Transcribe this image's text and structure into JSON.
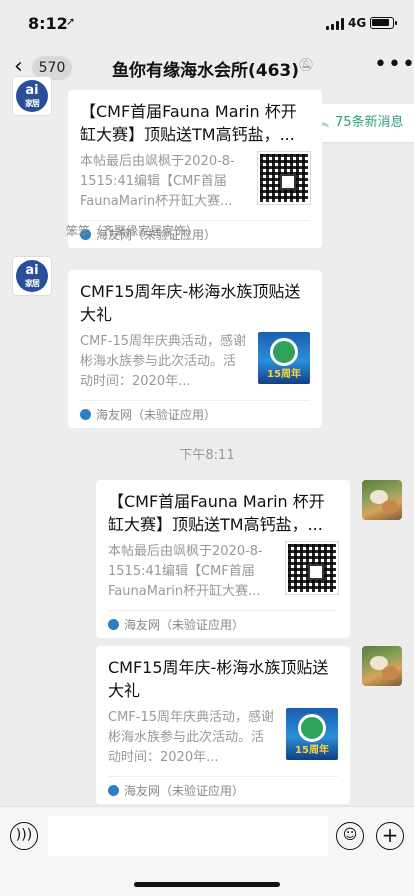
{
  "status_bar": {
    "time": "8:12",
    "location_icon": "location-arrow-icon",
    "network": "4G"
  },
  "nav": {
    "back_icon": "chevron-left-icon",
    "unread_count": "570",
    "title": "鱼你有缘海水会所(463)",
    "mute_icon": "bell-off-icon",
    "more_icon": "ellipsis-icon"
  },
  "new_messages": {
    "label": "75条新消息",
    "icon": "double-chevron-up-icon"
  },
  "time_divider": "下午8:11",
  "messages": [
    {
      "side": "left",
      "sender": "",
      "title": "【CMF首届Fauna Marin 杯开缸大赛】顶贴送TM高钙盐，...",
      "description": "本帖最后由飒枫于2020-8-1515:41编辑【CMF首届FaunaMarin杯开缸大赛...",
      "source": "海友网（未验证应用）",
      "thumb": "qr-code"
    },
    {
      "side": "left",
      "sender": "笨笨（齐聚缘家居家饰）",
      "title": "CMF15周年庆-彬海水族顶贴送大礼",
      "description": "CMF-15周年庆典活动，感谢彬海水族参与此次活动。活动时间：2020年...",
      "source": "海友网（未验证应用）",
      "thumb": "anniversary",
      "thumb_label": "15周年"
    },
    {
      "side": "right",
      "sender": "",
      "title": "【CMF首届Fauna Marin 杯开缸大赛】顶贴送TM高钙盐，...",
      "description": "本帖最后由飒枫于2020-8-1515:41编辑【CMF首届FaunaMarin杯开缸大赛...",
      "source": "海友网（未验证应用）",
      "thumb": "qr-code"
    },
    {
      "side": "right",
      "sender": "",
      "title": "CMF15周年庆-彬海水族顶贴送大礼",
      "description": "CMF-15周年庆典活动，感谢彬海水族参与此次活动。活动时间：2020年...",
      "source": "海友网（未验证应用）",
      "thumb": "anniversary",
      "thumb_label": "15周年"
    }
  ],
  "input_bar": {
    "voice_icon": "voice-icon",
    "emoji_icon": "emoji-icon",
    "plus_icon": "plus-icon",
    "text": ""
  }
}
